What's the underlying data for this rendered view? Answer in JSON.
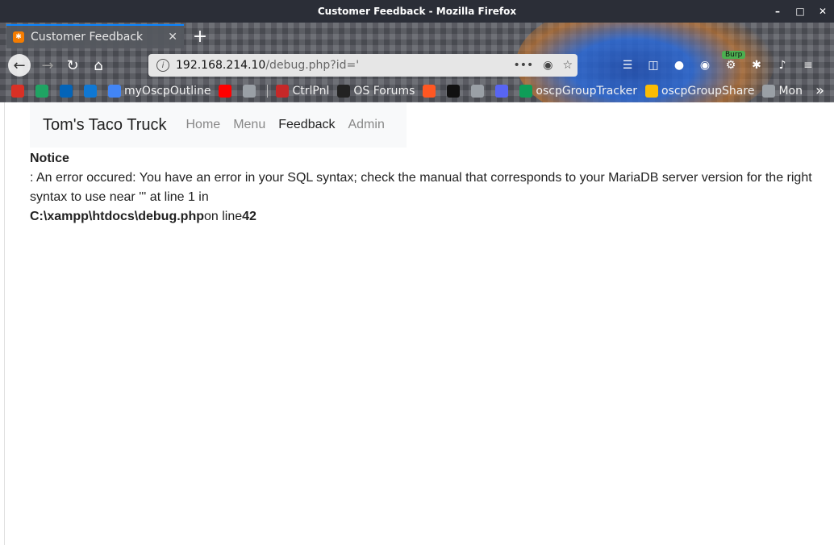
{
  "window": {
    "title": "Customer Feedback - Mozilla Firefox",
    "controls": [
      "–",
      "□",
      "✕"
    ]
  },
  "tab": {
    "title": "Customer Feedback",
    "close": "✕",
    "new_tab": "+"
  },
  "toolbar": {
    "url_host": "192.168.214.10",
    "url_path": "/debug.php?id='",
    "more": "•••",
    "burp_badge": "Burp"
  },
  "bookmarks": [
    {
      "label": "",
      "icon": "gmail-icon",
      "color": "#d93025"
    },
    {
      "label": "",
      "icon": "drive-icon",
      "color": "#1fa463"
    },
    {
      "label": "",
      "icon": "outlook-icon",
      "color": "#0364b8"
    },
    {
      "label": "",
      "icon": "onedrive-icon",
      "color": "#0f78d4"
    },
    {
      "label": "myOscpOutline",
      "icon": "docs-icon",
      "color": "#4285f4"
    },
    {
      "label": "",
      "icon": "youtube-icon",
      "color": "#ff0000"
    },
    {
      "label": "",
      "icon": "globe-icon",
      "color": "#9aa0a6"
    },
    {
      "label": "CtrlPnl",
      "icon": "ctrlpnl-icon",
      "color": "#c62828"
    },
    {
      "label": "OS Forums",
      "icon": "forums-icon",
      "color": "#222222"
    },
    {
      "label": "",
      "icon": "bolt-icon",
      "color": "#ff5722"
    },
    {
      "label": "",
      "icon": "github-icon",
      "color": "#111111"
    },
    {
      "label": "",
      "icon": "globe-icon",
      "color": "#9aa0a6"
    },
    {
      "label": "",
      "icon": "discord-icon",
      "color": "#5865f2"
    },
    {
      "label": "oscpGroupTracker",
      "icon": "sheets-icon",
      "color": "#0f9d58"
    },
    {
      "label": "oscpGroupShare",
      "icon": "drive-icon",
      "color": "#fbbc04"
    },
    {
      "label": "Mon",
      "icon": "globe-icon",
      "color": "#9aa0a6"
    }
  ],
  "site": {
    "brand": "Tom's Taco Truck",
    "nav": [
      "Home",
      "Menu",
      "Feedback",
      "Admin"
    ],
    "active": "Feedback"
  },
  "error": {
    "heading": "Notice",
    "message": ": An error occured: You have an error in your SQL syntax; check the manual that corresponds to your MariaDB server version for the right syntax to use near ''' at line 1 in",
    "file": "C:\\xampp\\htdocs\\debug.php",
    "on_line": "on line",
    "line": "42"
  }
}
